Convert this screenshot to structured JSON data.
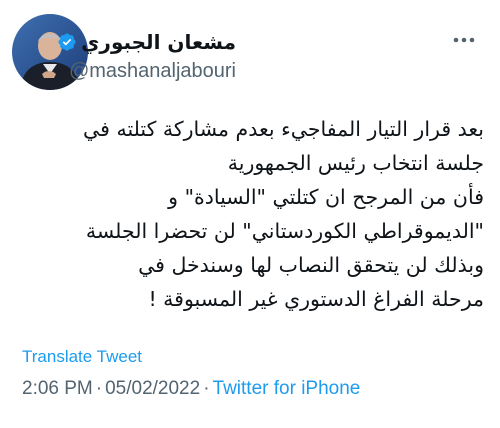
{
  "author": {
    "display_name": "مشعان الجبوري",
    "handle": "@mashanaljabouri",
    "verified": true
  },
  "tweet": {
    "lines": [
      "بعد قرار التيار المفاجيء بعدم مشاركة كتلته في",
      "جلسة انتخاب رئيس الجمهورية",
      "فأن من المرجح  ان كتلتي \"السيادة\" و",
      "\"الديموقراطي الكوردستاني\" لن تحضرا الجلسة",
      "وبذلك لن يتحقق النصاب لها  وسندخل في",
      "مرحلة الفراغ الدستوري غير المسبوقة !"
    ],
    "translate_label": "Translate Tweet",
    "time": "2:06 PM",
    "date": "05/02/2022",
    "separator": "·",
    "source": "Twitter for iPhone"
  },
  "colors": {
    "link": "#1d9bf0",
    "secondary_text": "#536471",
    "primary_text": "#0f1419"
  },
  "icons": {
    "more": "more-icon",
    "verified": "verified-badge-icon"
  }
}
